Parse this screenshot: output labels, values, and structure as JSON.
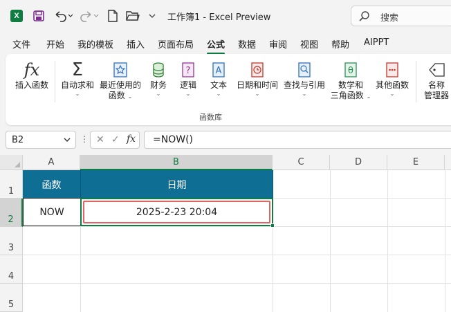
{
  "titlebar": {
    "app_logo": "X",
    "title": "工作簿1  -  Excel Preview",
    "search_placeholder": "搜索",
    "icons": [
      "excel-logo",
      "save-icon",
      "undo-icon",
      "redo-icon",
      "new-file-icon",
      "open-folder-icon",
      "more-icon",
      "search-icon"
    ]
  },
  "menu": {
    "tabs": [
      "文件",
      "开始",
      "我的模板",
      "插入",
      "页面布局",
      "公式",
      "数据",
      "审阅",
      "视图",
      "帮助",
      "AIPPT"
    ],
    "active": "公式"
  },
  "ribbon": {
    "insert_function": "插入函数",
    "autosum": "自动求和",
    "recent_1": "最近使用的",
    "recent_2": "函数",
    "financial": "财务",
    "logical": "逻辑",
    "text": "文本",
    "datetime": "日期和时间",
    "lookup": "查找与引用",
    "math_1": "数学和",
    "math_2": "三角函数",
    "more_functions": "其他函数",
    "name_mgr_1": "名称",
    "name_mgr_2": "管理器",
    "group_label": "函数库",
    "fx_symbol": "fx"
  },
  "formula_bar": {
    "name_box": "B2",
    "formula": "=NOW()",
    "fx_label": "fx"
  },
  "sheet": {
    "columns": [
      "A",
      "B",
      "C",
      "D",
      "E"
    ],
    "rows": [
      "1",
      "2",
      "3",
      "4",
      "5"
    ],
    "selected_column": "B",
    "selected_row": "2",
    "cells": {
      "A1": "函数",
      "B1": "日期",
      "A2": "NOW",
      "B2": "2025-2-23 20:04"
    },
    "header_fill": "#0f6e94",
    "selection_color": "#107c41",
    "highlight_color": "#e06666"
  }
}
